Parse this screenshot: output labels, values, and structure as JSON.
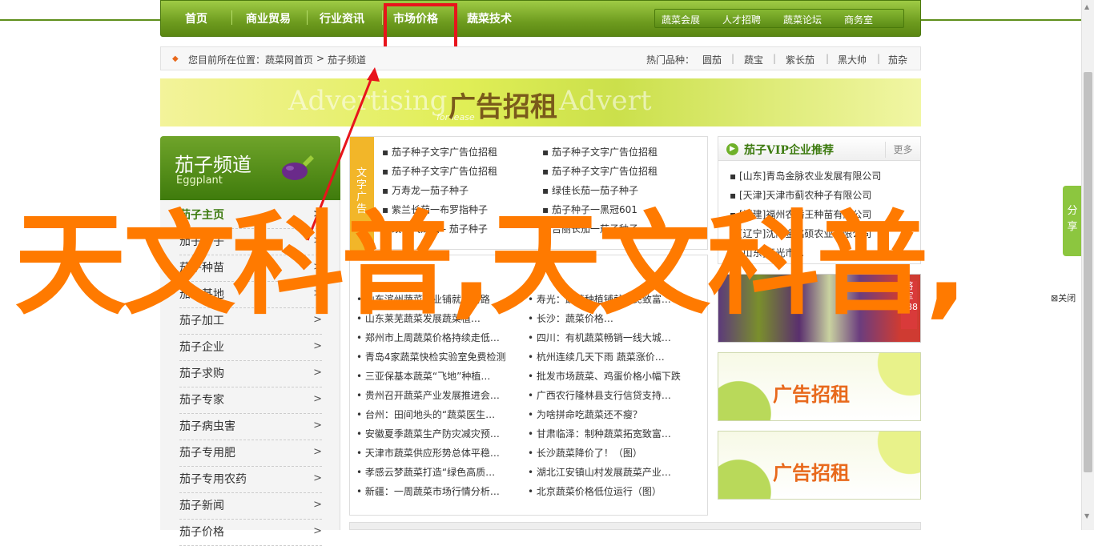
{
  "nav": {
    "items": [
      "首页",
      "商业贸易",
      "行业资讯",
      "市场价格",
      "蔬菜技术"
    ],
    "right_links": [
      "蔬菜会展",
      "人才招聘",
      "蔬菜论坛",
      "商务室"
    ]
  },
  "breadcrumb": {
    "label": "您目前所在位置：",
    "home": "蔬菜网首页",
    "sep": ">",
    "current": "茄子频道",
    "hot_label": "热门品种：",
    "hot_items": [
      "圆茄",
      "|",
      "蔬宝",
      "|",
      "紫长茄",
      "|",
      "黑大帅",
      "|",
      "茄杂"
    ]
  },
  "banner": {
    "faint_left": "Advertising",
    "faint_right": "Advert",
    "sub": "for lease",
    "main": "广告招租"
  },
  "sidebar": {
    "title": "茄子频道",
    "subtitle": "Eggplant",
    "items": [
      "茄子主页",
      "茄子种子",
      "茄子种苗",
      "茄子基地",
      "茄子加工",
      "茄子企业",
      "茄子求购",
      "茄子专家",
      "茄子病虫害",
      "茄子专用肥",
      "茄子专用农药",
      "茄子新闻",
      "茄子价格"
    ],
    "arrow": ">"
  },
  "text_ads": {
    "tab_label": "文字广告",
    "left": [
      "茄子种子文字广告位招租",
      "茄子种子文字广告位招租",
      "万寿龙一茄子种子",
      "紫兰长茄一布罗指种子",
      "改良大龙茄 - 茄子种子"
    ],
    "right": [
      "茄子种子文字广告位招租",
      "茄子种子文字广告位招租",
      "绿佳长茄一茄子种子",
      "茄子种子一黑冠601",
      "吉丽长茄一茄子种子"
    ]
  },
  "news": {
    "left": [
      "山东滨州蔬菜产业铺就致富路",
      "山东莱芜蔬菜发展蔬菜植…",
      "郑州市上周蔬菜价格持续走低…",
      "青岛4家蔬菜快检实验室免费检测",
      "三亚保基本蔬菜“飞地”种植…",
      "贵州召开蔬菜产业发展推进会…",
      "台州：田间地头的“蔬菜医生…",
      "安徽夏季蔬菜生产防灾减灾预…",
      "天津市蔬菜供应形势总体平稳…",
      "孝感云梦蔬菜打造“绿色高质…",
      "新疆：一周蔬菜市场行情分析…"
    ],
    "right": [
      "寿光：蔬菜种植铺就农民致富…",
      "长沙：蔬菜价格…",
      "四川：有机蔬菜畅销一线大城…",
      "杭州连续几天下雨 蔬菜涨价…",
      "批发市场蔬菜、鸡蛋价格小幅下跌",
      "广西农行隆林县支行信贷支持…",
      "为啥拼命吃蔬菜还不瘦？",
      "甘肃临泽：制种蔬菜拓宽致富…",
      "长沙蔬菜降价了！（图）",
      "湖北江安镇山村发展蔬菜产业…",
      "北京蔬菜价格低位运行（图）"
    ]
  },
  "vip": {
    "title": "茄子VIP企业推荐",
    "more": "更多",
    "items": [
      "[山东]青岛金脉农业发展有限公司",
      "[天津]天津市蓟农种子有限公司",
      "[福建]福州农播王种苗有限公司",
      "[辽宁]沈阳金铭硕农业有限公司",
      "[山东]寿光市…"
    ]
  },
  "photo_tag": "将军888",
  "ad_boxes": [
    "广告招租",
    "广告招租"
  ],
  "share": "分享",
  "close": "关闭",
  "overlay_text": "天文科普,天文科普,",
  "colors": {
    "nav_green": "#6e9c1f",
    "accent_orange": "#ff7a00",
    "highlight_red": "#e8141c"
  }
}
